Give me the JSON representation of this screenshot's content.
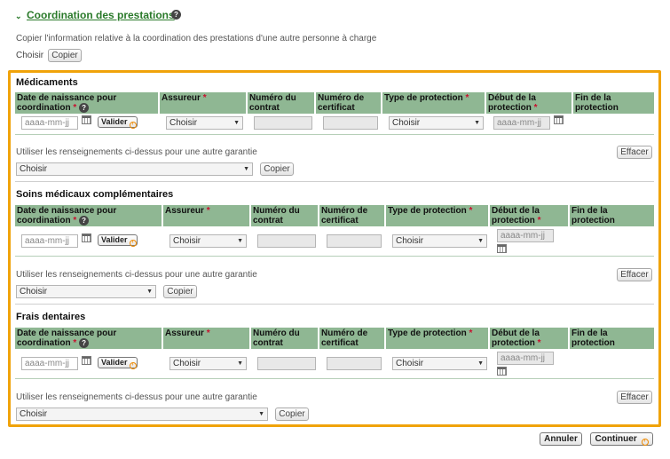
{
  "header": {
    "section_link": "Coordination des prestations",
    "copy_text": "Copier l'information relative à la coordination des prestations d'une autre personne à charge",
    "choose_label": "Choisir",
    "copy_button": "Copier"
  },
  "columns": {
    "dob": "Date de naissance pour coordination",
    "insurer": "Assureur",
    "contract": "Numéro du contrat",
    "certificate": "Numéro de certificat",
    "protection_type": "Type de protection",
    "start": "Début de la protection",
    "end": "Fin de la protection",
    "required": "*"
  },
  "common": {
    "date_placeholder": "aaaa-mm-jj",
    "validate_button": "Valider",
    "choose": "Choisir",
    "reuse_label": "Utiliser les renseignements ci-dessus pour une autre garantie",
    "clear_button": "Effacer",
    "copy_button": "Copier",
    "help": "?"
  },
  "sections": [
    {
      "title": "Médicaments"
    },
    {
      "title": "Soins médicaux complémentaires"
    },
    {
      "title": "Frais dentaires"
    }
  ],
  "footer": {
    "cancel_button": "Annuler",
    "continue_button": "Continuer"
  }
}
